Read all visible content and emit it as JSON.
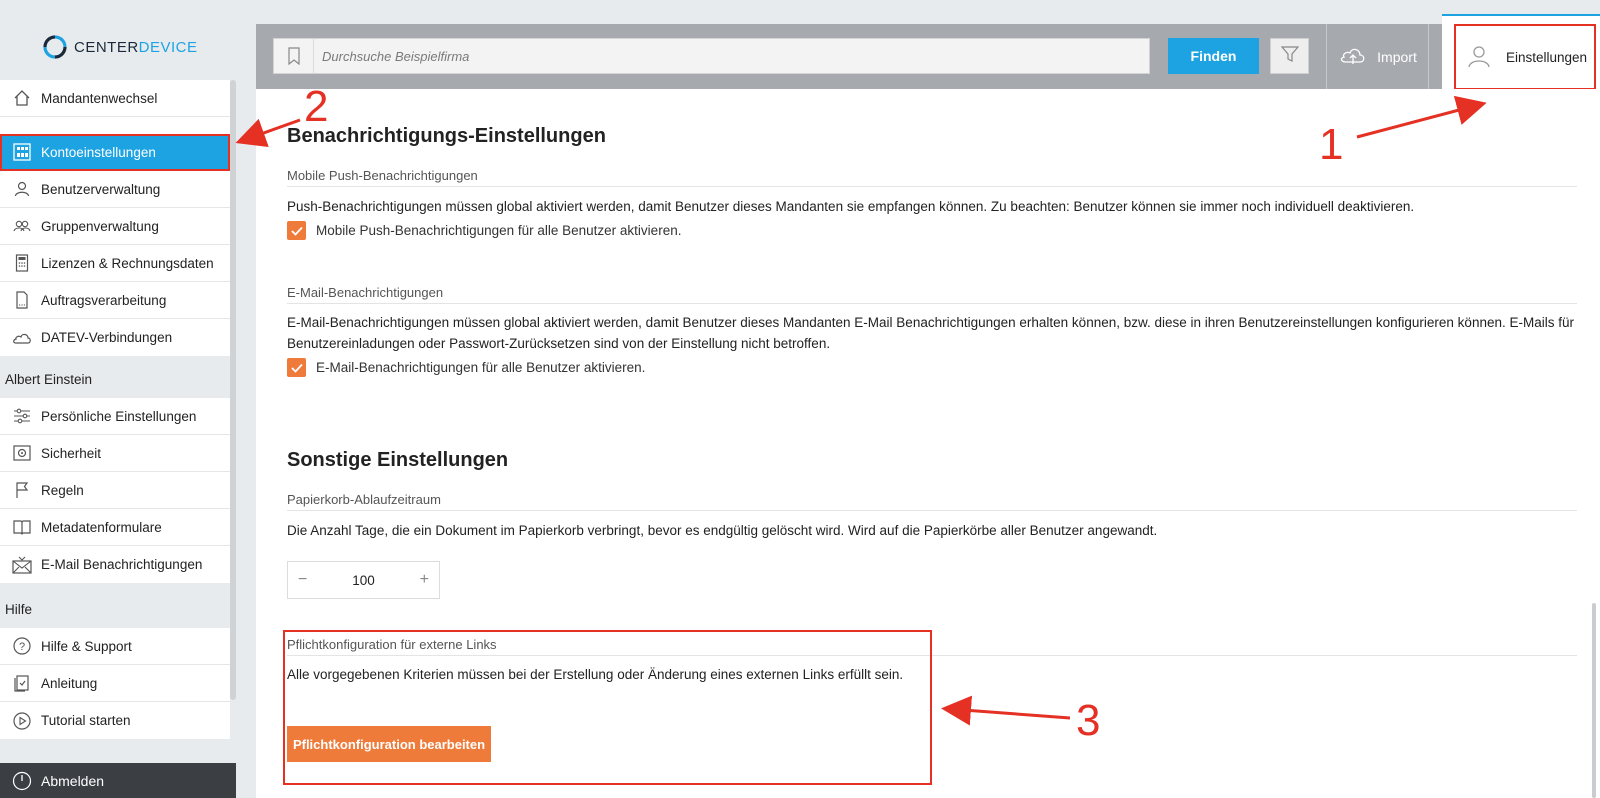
{
  "logo": {
    "part1": "CENTER",
    "part2": "DEVICE"
  },
  "sidebar": {
    "group1": [
      {
        "label": "Mandantenwechsel",
        "icon": "home-icon"
      },
      {
        "label": "Kontoeinstellungen",
        "icon": "grid-icon",
        "active": true
      },
      {
        "label": "Benutzerverwaltung",
        "icon": "user-icon"
      },
      {
        "label": "Gruppenverwaltung",
        "icon": "users-icon"
      },
      {
        "label": "Lizenzen & Rechnungsdaten",
        "icon": "calculator-icon"
      },
      {
        "label": "Auftragsverarbeitung",
        "icon": "document-icon"
      },
      {
        "label": "DATEV-Verbindungen",
        "icon": "cloud-icon"
      }
    ],
    "section2_label": "Albert Einstein",
    "group2": [
      {
        "label": "Persönliche Einstellungen",
        "icon": "sliders-icon"
      },
      {
        "label": "Sicherheit",
        "icon": "safe-icon"
      },
      {
        "label": "Regeln",
        "icon": "flag-icon"
      },
      {
        "label": "Metadatenformulare",
        "icon": "book-icon"
      },
      {
        "label": "E-Mail Benachrichtigungen",
        "icon": "mail-icon"
      }
    ],
    "section3_label": "Hilfe",
    "group3": [
      {
        "label": "Hilfe & Support",
        "icon": "question-icon"
      },
      {
        "label": "Anleitung",
        "icon": "guide-icon"
      },
      {
        "label": "Tutorial starten",
        "icon": "play-icon"
      }
    ],
    "logout_label": "Abmelden"
  },
  "topbar": {
    "search_placeholder": "Durchsuche Beispielfirma",
    "find_label": "Finden",
    "import_label": "Import",
    "settings_label": "Einstellungen"
  },
  "main": {
    "notifications_title": "Benachrichtigungs-Einstellungen",
    "push_subhead": "Mobile Push-Benachrichtigungen",
    "push_text": "Push-Benachrichtigungen müssen global aktiviert werden, damit Benutzer dieses Mandanten sie empfangen können. Zu beachten: Benutzer können sie immer noch individuell deaktivieren.",
    "push_checkbox": "Mobile Push-Benachrichtigungen für alle Benutzer aktivieren.",
    "email_subhead": "E-Mail-Benachrichtigungen",
    "email_text_line1": "E-Mail-Benachrichtigungen müssen global aktiviert werden, damit Benutzer dieses Mandanten E-Mail Benachrichtigungen erhalten können, bzw. diese in ihren Benutzereinstellungen konfigurieren können. E-Mails für",
    "email_text_line2": "Benutzereinladungen oder Passwort-Zurücksetzen sind von der Einstellung nicht betroffen.",
    "email_checkbox": "E-Mail-Benachrichtigungen für alle Benutzer aktivieren.",
    "other_title": "Sonstige Einstellungen",
    "trash_subhead": "Papierkorb-Ablaufzeitraum",
    "trash_text": "Die Anzahl Tage, die ein Dokument im Papierkorb verbringt, bevor es endgültig gelöscht wird. Wird auf die Papierkörbe aller Benutzer angewandt.",
    "trash_value": "100",
    "links_subhead": "Pflichtkonfiguration für externe Links",
    "links_text": "Alle vorgegebenen Kriterien müssen bei der Erstellung oder Änderung eines externen Links erfüllt sein.",
    "links_button": "Pflichtkonfiguration bearbeiten"
  },
  "annotations": {
    "n1": "1",
    "n2": "2",
    "n3": "3"
  },
  "colors": {
    "accent_blue": "#1ea3e2",
    "accent_orange": "#ef7b3a",
    "annotation_red": "#e53024"
  }
}
